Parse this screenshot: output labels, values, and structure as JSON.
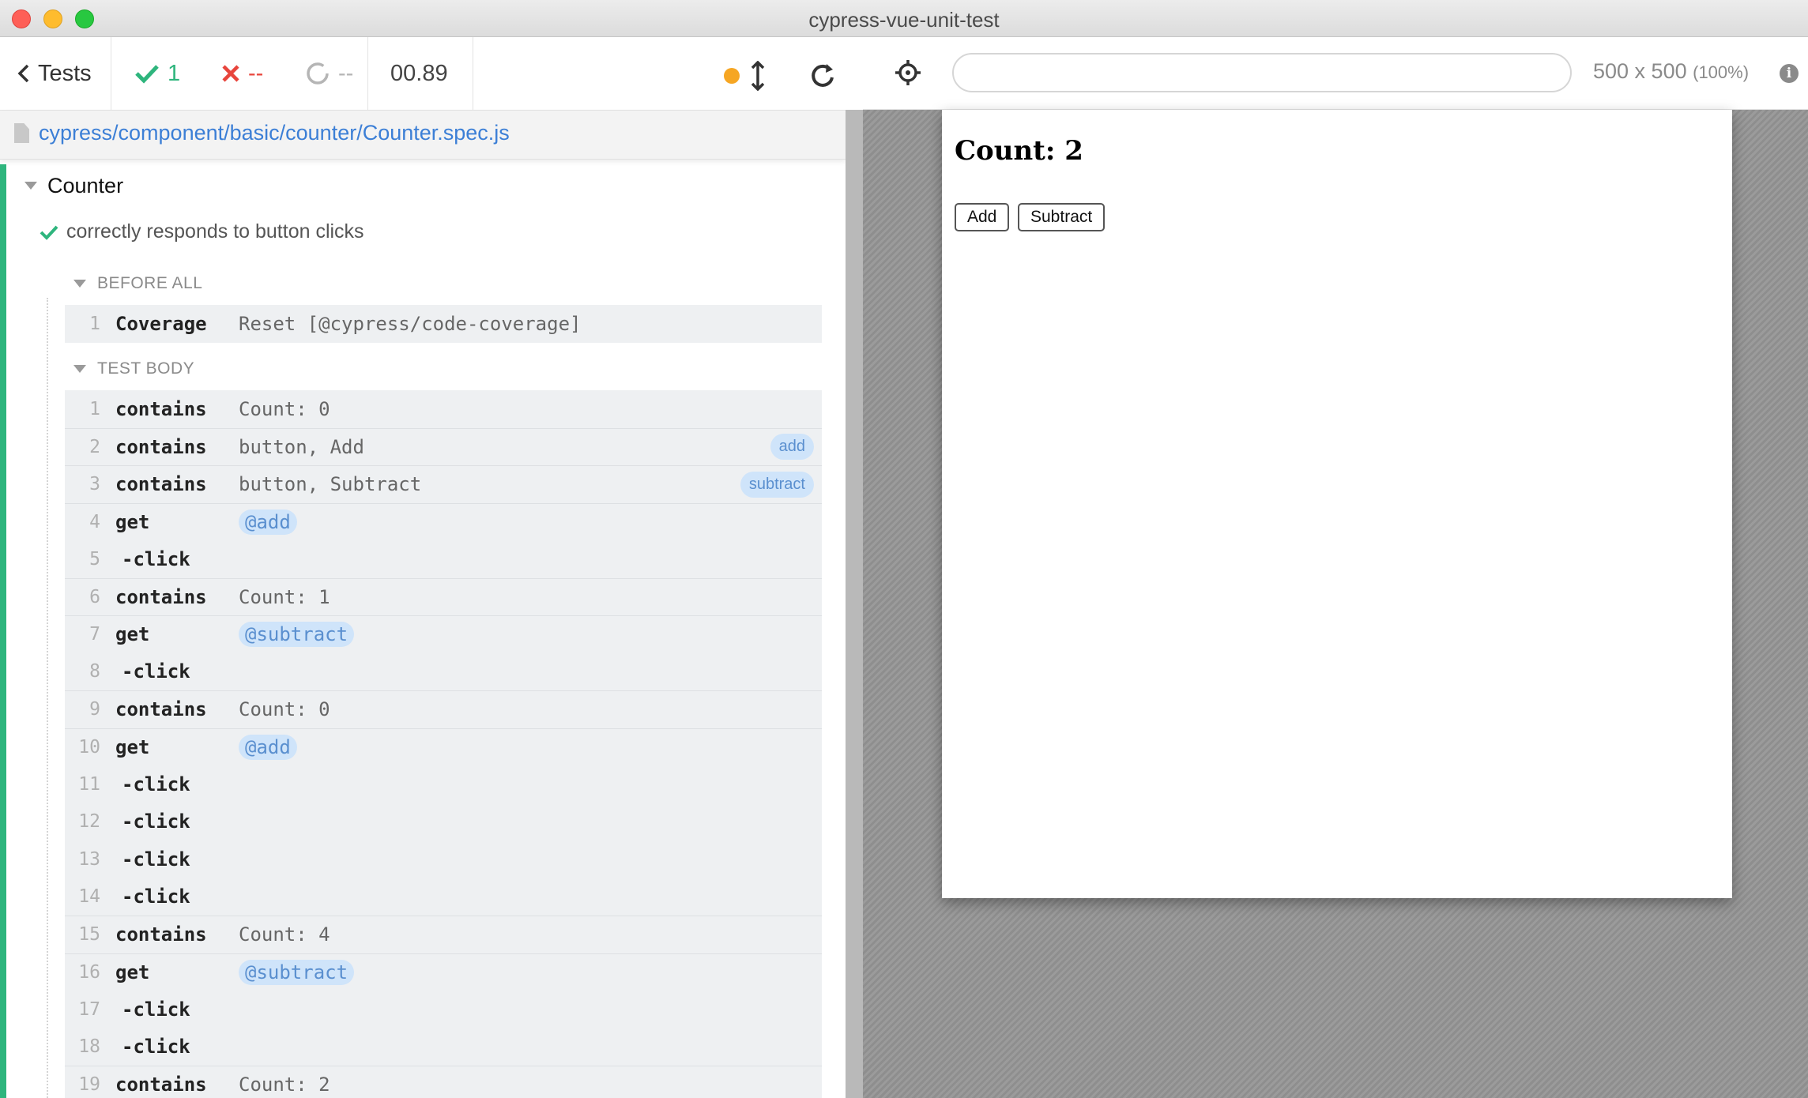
{
  "window": {
    "title": "cypress-vue-unit-test"
  },
  "toolbar": {
    "back_label": "Tests",
    "passed": "1",
    "failed": "--",
    "pending": "--",
    "duration": "00.89"
  },
  "spec": {
    "path": "cypress/component/basic/counter/Counter.spec.js"
  },
  "suite": {
    "title": "Counter"
  },
  "test": {
    "title": "correctly responds to button clicks"
  },
  "hooks": {
    "before_all": {
      "title": "BEFORE ALL",
      "commands": [
        {
          "num": "1",
          "name": "Coverage",
          "message": "Reset [@cypress/code-coverage]"
        }
      ]
    },
    "test_body": {
      "title": "TEST BODY",
      "commands": [
        {
          "num": "1",
          "name": "contains",
          "message": "Count: 0"
        },
        {
          "num": "2",
          "name": "contains",
          "message": "button, Add",
          "alias": "add"
        },
        {
          "num": "3",
          "name": "contains",
          "message": "button, Subtract",
          "alias": "subtract"
        },
        {
          "num": "4",
          "name": "get",
          "alias_message": "@add"
        },
        {
          "num": "5",
          "name": "-click"
        },
        {
          "num": "6",
          "name": "contains",
          "message": "Count: 1"
        },
        {
          "num": "7",
          "name": "get",
          "alias_message": "@subtract"
        },
        {
          "num": "8",
          "name": "-click"
        },
        {
          "num": "9",
          "name": "contains",
          "message": "Count: 0"
        },
        {
          "num": "10",
          "name": "get",
          "alias_message": "@add"
        },
        {
          "num": "11",
          "name": "-click"
        },
        {
          "num": "12",
          "name": "-click"
        },
        {
          "num": "13",
          "name": "-click"
        },
        {
          "num": "14",
          "name": "-click"
        },
        {
          "num": "15",
          "name": "contains",
          "message": "Count: 4"
        },
        {
          "num": "16",
          "name": "get",
          "alias_message": "@subtract"
        },
        {
          "num": "17",
          "name": "-click"
        },
        {
          "num": "18",
          "name": "-click"
        },
        {
          "num": "19",
          "name": "contains",
          "message": "Count: 2"
        }
      ]
    }
  },
  "preview": {
    "url": "",
    "viewport": "500 x 500",
    "scale": "(100%)",
    "heading": "Count: 2",
    "add_label": "Add",
    "subtract_label": "Subtract"
  },
  "colors": {
    "passed": "#2eb57d",
    "failed": "#e8453c",
    "link": "#3c7fd6",
    "alias_bg": "#cfe4fa",
    "running_dot": "#f6a623"
  },
  "icons": [
    "chevron-left-icon",
    "check-icon",
    "x-icon",
    "pending-circle-icon",
    "running-dot-icon",
    "resize-icon",
    "reload-icon",
    "crosshair-icon",
    "info-icon",
    "file-icon",
    "triangle-down-icon"
  ]
}
